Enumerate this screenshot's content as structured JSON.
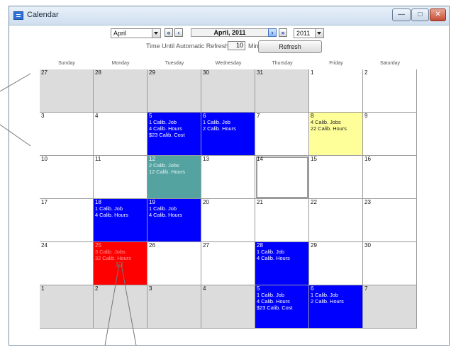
{
  "window": {
    "title": "Calendar",
    "controls": {
      "minimize": "—",
      "maximize": "□",
      "close": "✕"
    }
  },
  "toolbar": {
    "month_select": "April",
    "nav_buttons": [
      "«",
      "‹",
      "›",
      "»"
    ],
    "title": "April, 2011",
    "year_select": "2011",
    "refresh_label": "Time Until Automatic Refresh",
    "refresh_value": "10",
    "refresh_unit": "Min",
    "refresh_button": "Refresh"
  },
  "days": [
    "Sunday",
    "Monday",
    "Tuesday",
    "Wednesday",
    "Thursday",
    "Friday",
    "Saturday"
  ],
  "calendar": [
    [
      {
        "num": "27",
        "style": "gray",
        "events": []
      },
      {
        "num": "28",
        "style": "gray",
        "events": []
      },
      {
        "num": "29",
        "style": "gray",
        "events": []
      },
      {
        "num": "30",
        "style": "gray",
        "events": []
      },
      {
        "num": "31",
        "style": "gray",
        "events": []
      },
      {
        "num": "1",
        "style": "white",
        "events": []
      },
      {
        "num": "2",
        "style": "white",
        "events": []
      }
    ],
    [
      {
        "num": "3",
        "style": "white",
        "events": []
      },
      {
        "num": "4",
        "style": "white",
        "events": []
      },
      {
        "num": "5",
        "style": "blue",
        "events": [
          "1 Calib. Job",
          "4 Calib. Hours",
          "$23 Calib. Cost"
        ]
      },
      {
        "num": "6",
        "style": "blue",
        "events": [
          "1 Calib. Job",
          "2 Calib. Hours"
        ]
      },
      {
        "num": "7",
        "style": "white",
        "events": []
      },
      {
        "num": "8",
        "style": "yellow",
        "events": [
          "4 Calib. Jobs",
          "22 Calib. Hours"
        ]
      },
      {
        "num": "9",
        "style": "white",
        "events": []
      }
    ],
    [
      {
        "num": "10",
        "style": "white",
        "events": []
      },
      {
        "num": "11",
        "style": "white",
        "events": []
      },
      {
        "num": "12",
        "style": "teal",
        "events": [
          "2 Calib. Jobs",
          "12 Calib. Hours"
        ]
      },
      {
        "num": "13",
        "style": "white",
        "events": []
      },
      {
        "num": "14",
        "style": "selected",
        "events": []
      },
      {
        "num": "15",
        "style": "white",
        "events": []
      },
      {
        "num": "16",
        "style": "white",
        "events": []
      }
    ],
    [
      {
        "num": "17",
        "style": "white",
        "events": []
      },
      {
        "num": "18",
        "style": "blue",
        "events": [
          "1 Calib. Job",
          "4 Calib. Hours"
        ]
      },
      {
        "num": "19",
        "style": "blue",
        "events": [
          "1 Calib. Job",
          "4 Calib. Hours"
        ]
      },
      {
        "num": "20",
        "style": "white",
        "events": []
      },
      {
        "num": "21",
        "style": "white",
        "events": []
      },
      {
        "num": "22",
        "style": "white",
        "events": []
      },
      {
        "num": "23",
        "style": "white",
        "events": []
      }
    ],
    [
      {
        "num": "24",
        "style": "white",
        "events": []
      },
      {
        "num": "25",
        "style": "red",
        "events": [
          "3 Calib. Jobs",
          "32 Calib. Hours"
        ]
      },
      {
        "num": "26",
        "style": "white",
        "events": []
      },
      {
        "num": "27",
        "style": "white",
        "events": []
      },
      {
        "num": "28",
        "style": "blue",
        "events": [
          "1 Calib. Job",
          "4 Calib. Hours"
        ]
      },
      {
        "num": "29",
        "style": "white",
        "events": []
      },
      {
        "num": "30",
        "style": "white",
        "events": []
      }
    ],
    [
      {
        "num": "1",
        "style": "gray",
        "events": []
      },
      {
        "num": "2",
        "style": "gray",
        "events": []
      },
      {
        "num": "3",
        "style": "gray",
        "events": []
      },
      {
        "num": "4",
        "style": "gray",
        "events": []
      },
      {
        "num": "5",
        "style": "blue",
        "events": [
          "1 Calib. Job",
          "4 Calib. Hours",
          "$23 Calib. Cost"
        ]
      },
      {
        "num": "6",
        "style": "blue",
        "events": [
          "1 Calib. Job",
          "2 Calib. Hours"
        ]
      },
      {
        "num": "7",
        "style": "gray",
        "events": []
      }
    ]
  ],
  "colors": {
    "blue": "#0000ff",
    "yellow": "#ffff99",
    "teal": "#55a3a1",
    "red": "#ff0000",
    "gray": "#dcdcdc"
  }
}
